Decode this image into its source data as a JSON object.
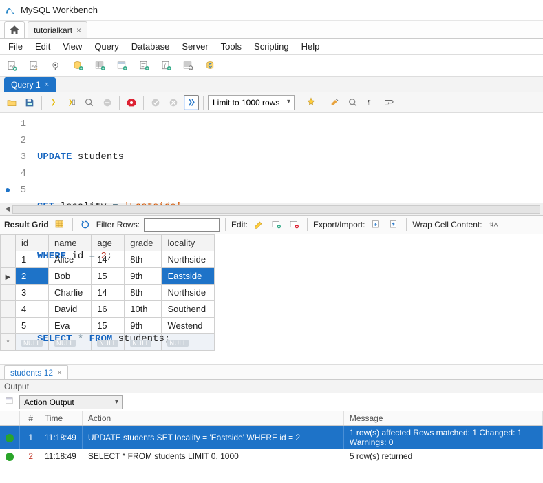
{
  "window": {
    "title": "MySQL Workbench"
  },
  "connection_tab": {
    "label": "tutorialkart"
  },
  "menu": {
    "items": [
      "File",
      "Edit",
      "View",
      "Query",
      "Database",
      "Server",
      "Tools",
      "Scripting",
      "Help"
    ]
  },
  "query_tab": {
    "label": "Query 1"
  },
  "editor_toolbar": {
    "limit_select": "Limit to 1000 rows"
  },
  "sql": {
    "lines": [
      {
        "n": "1",
        "html": "<span class='kw'>UPDATE</span> students"
      },
      {
        "n": "2",
        "html": "<span class='kw'>SET</span> locality <span class='op'>=</span> <span class='str'>'Eastside'</span>"
      },
      {
        "n": "3",
        "html": "<span class='kw'>WHERE</span> id <span class='op'>=</span> <span class='num'>2</span>;"
      },
      {
        "n": "4",
        "html": ""
      },
      {
        "n": "5",
        "html": "<span class='kw'>SELECT</span> <span class='op'>*</span> <span class='kw'>FROM</span> students;",
        "marker": true
      }
    ]
  },
  "resultbar": {
    "result_grid": "Result Grid",
    "filter_label": "Filter Rows:",
    "edit_label": "Edit:",
    "export_label": "Export/Import:",
    "wrap_label": "Wrap Cell Content:"
  },
  "grid": {
    "columns": [
      "id",
      "name",
      "age",
      "grade",
      "locality"
    ],
    "rows": [
      {
        "id": "1",
        "name": "Alice",
        "age": "14",
        "grade": "8th",
        "locality": "Northside",
        "selected": false
      },
      {
        "id": "2",
        "name": "Bob",
        "age": "15",
        "grade": "9th",
        "locality": "Eastside",
        "selected": true,
        "highlight_cell": "locality"
      },
      {
        "id": "3",
        "name": "Charlie",
        "age": "14",
        "grade": "8th",
        "locality": "Northside",
        "selected": false
      },
      {
        "id": "4",
        "name": "David",
        "age": "16",
        "grade": "10th",
        "locality": "Southend",
        "selected": false
      },
      {
        "id": "5",
        "name": "Eva",
        "age": "15",
        "grade": "9th",
        "locality": "Westend",
        "selected": false
      }
    ],
    "null_label": "NULL"
  },
  "result_tab": {
    "label": "students 12"
  },
  "output": {
    "title": "Output",
    "dropdown": "Action Output",
    "columns": {
      "num": "#",
      "time": "Time",
      "action": "Action",
      "message": "Message"
    },
    "rows": [
      {
        "num": "1",
        "time": "11:18:49",
        "action": "UPDATE students SET locality = 'Eastside' WHERE id = 2",
        "message": "1 row(s) affected Rows matched: 1  Changed: 1  Warnings: 0",
        "selected": true
      },
      {
        "num": "2",
        "time": "11:18:49",
        "action": "SELECT * FROM students LIMIT 0, 1000",
        "message": "5 row(s) returned",
        "selected": false
      }
    ]
  },
  "colors": {
    "accent": "#1e73c8",
    "ok": "#2aa52a"
  }
}
